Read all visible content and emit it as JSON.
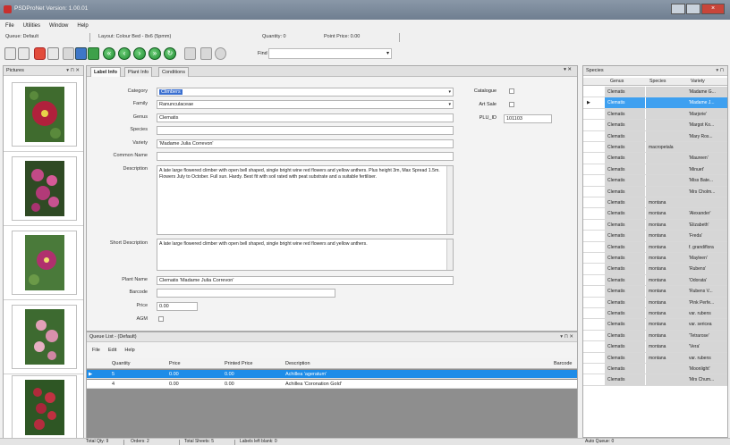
{
  "window": {
    "title": "PSDProNet Version: 1.00.01"
  },
  "menubar": [
    "File",
    "Utilities",
    "Window",
    "Help"
  ],
  "queuebar": {
    "queue": "Queue: Default",
    "layout": "Layout: Colour Bed - 8x6 (5pmm)",
    "quantity": "Quantity: 0",
    "price": "Point Price: 0.00"
  },
  "toolbar": {
    "find_label": "Find",
    "find_value": ""
  },
  "pictures": {
    "title": "Pictures"
  },
  "editor": {
    "tabs": [
      "Label Info",
      "Plant Info",
      "Conditions"
    ],
    "fields": {
      "category": "Climbers",
      "family": "Ranunculaceae",
      "genus": "Clematis",
      "species": "",
      "variety": "'Madame Julia Correvon'",
      "common_name": "",
      "description": "A late large flowered climber with open bell shaped, single bright wine red flowers and yellow anthers. Plus height 3m, Max Spread 1.5m. Flowers July to October. Full sun. Hardy. Best fit with soil rated with peat substrate and a suitable fertiliser.",
      "short_description": "A late large flowered climber with open bell shaped, single bright wine red flowers and yellow anthers.",
      "plant_name": "Clematis 'Madame Julia Correvon'",
      "barcode": "",
      "price": "0.00",
      "agm": ""
    },
    "labels": {
      "category": "Category",
      "family": "Family",
      "genus": "Genus",
      "species": "Species",
      "variety": "Variety",
      "common_name": "Common Name",
      "description": "Description",
      "short_description": "Short Description",
      "plant_name": "Plant Name",
      "barcode": "Barcode",
      "price": "Price",
      "agm": "AGM"
    },
    "right": {
      "catalogue": "Catalogue",
      "art_sale": "Art Sale",
      "plu_id_label": "PLU_ID",
      "plu_id": "101103"
    }
  },
  "queue": {
    "title": "Queue List - (Default)",
    "menu": [
      "File",
      "Edit",
      "Help"
    ],
    "columns": [
      "Quantity",
      "Price",
      "Printed Price",
      "Description",
      "Barcode"
    ],
    "rows": [
      {
        "quantity": "5",
        "price": "0.00",
        "printed": "0.00",
        "description": "Achillea 'ageratum'",
        "barcode": ""
      },
      {
        "quantity": "4",
        "price": "0.00",
        "printed": "0.00",
        "description": "Achillea 'Coronation Gold'",
        "barcode": ""
      }
    ]
  },
  "species": {
    "title": "Species",
    "columns": [
      "Genus",
      "Species",
      "Variety"
    ],
    "rows": [
      [
        "Clematis",
        "",
        "'Madame G..."
      ],
      [
        "Clematis",
        "",
        "'Madame J..."
      ],
      [
        "Clematis",
        "",
        "'Marjorie'"
      ],
      [
        "Clematis",
        "",
        "'Margot Ko..."
      ],
      [
        "Clematis",
        "",
        "'Mary Ros..."
      ],
      [
        "Clematis",
        "macropetala",
        ""
      ],
      [
        "Clematis",
        "",
        "'Maureen'"
      ],
      [
        "Clematis",
        "",
        "'Minuet'"
      ],
      [
        "Clematis",
        "",
        "'Miss Bate..."
      ],
      [
        "Clematis",
        "",
        "'Mrs Cholm..."
      ],
      [
        "Clematis",
        "montana",
        ""
      ],
      [
        "Clematis",
        "montana",
        "'Alexander'"
      ],
      [
        "Clematis",
        "montana",
        "'Elizabeth'"
      ],
      [
        "Clematis",
        "montana",
        "'Freda'"
      ],
      [
        "Clematis",
        "montana",
        "f. grandiflora"
      ],
      [
        "Clematis",
        "montana",
        "'Mayleen'"
      ],
      [
        "Clematis",
        "montana",
        "'Rubens'"
      ],
      [
        "Clematis",
        "montana",
        "'Odorata'"
      ],
      [
        "Clematis",
        "montana",
        "'Rubens V..."
      ],
      [
        "Clematis",
        "montana",
        "'Pink Perfe..."
      ],
      [
        "Clematis",
        "montana",
        "var. rubens"
      ],
      [
        "Clematis",
        "montana",
        "var. sericea"
      ],
      [
        "Clematis",
        "montana",
        "'Tetrarose'"
      ],
      [
        "Clematis",
        "montana",
        "'Vera'"
      ],
      [
        "Clematis",
        "montana",
        "var. rubens"
      ],
      [
        "Clematis",
        "",
        "'Moonlight'"
      ],
      [
        "Clematis",
        "",
        "'Mrs Chum..."
      ]
    ]
  },
  "status": {
    "total_qty": "Total Qty: 9",
    "orders": "Orders: 2",
    "total_sheets": "Total Sheets: 5",
    "labels_left": "Labels left blank: 0",
    "auto_queue": "Auto Queue: 0"
  }
}
